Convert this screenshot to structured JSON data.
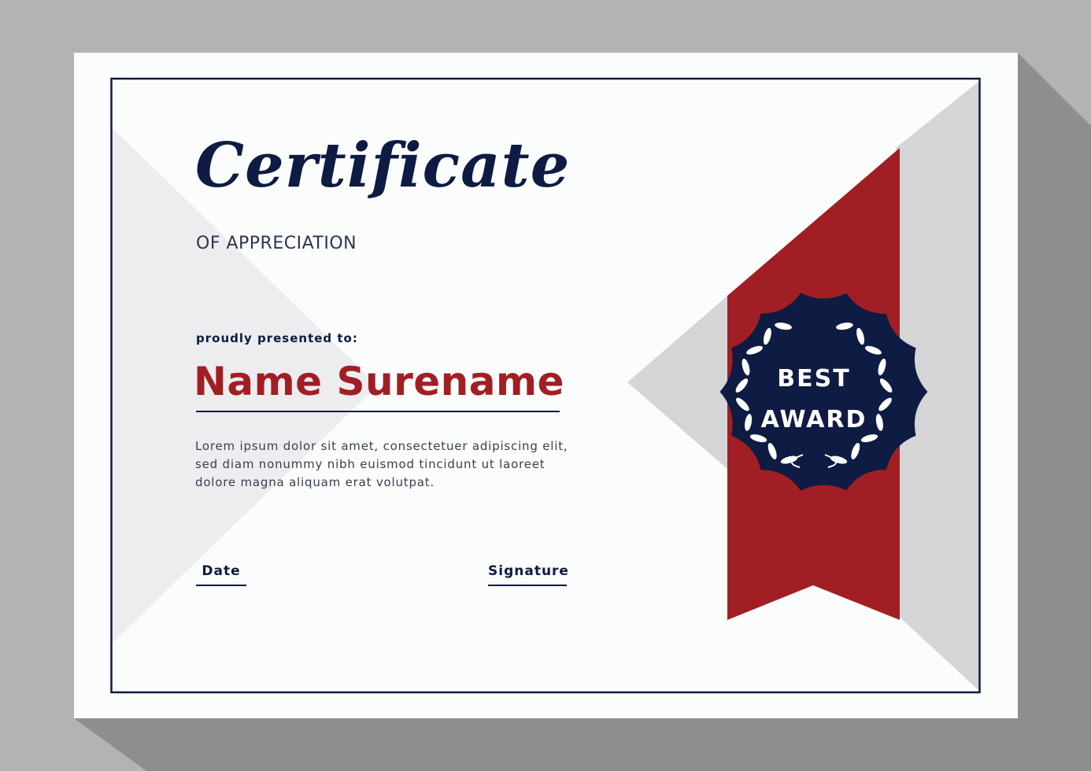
{
  "certificate": {
    "title": "Certificate",
    "subtitle": "OF APPRECIATION",
    "presented_label": "proudly presented to:",
    "recipient_name": "Name Surename",
    "body": "Lorem ipsum dolor sit amet, consectetuer adipiscing elit, sed diam nonummy nibh euismod tincidunt ut laoreet dolore magna aliquam erat volutpat.",
    "date_label": "Date",
    "signature_label": "Signature"
  },
  "badge": {
    "line1": "BEST",
    "line2": "AWARD"
  },
  "colors": {
    "navy": "#0e1b42",
    "red": "#a11f24",
    "paper": "#fbfcfc",
    "gray": "#d5d5d7",
    "background": "#b3b3b3"
  }
}
